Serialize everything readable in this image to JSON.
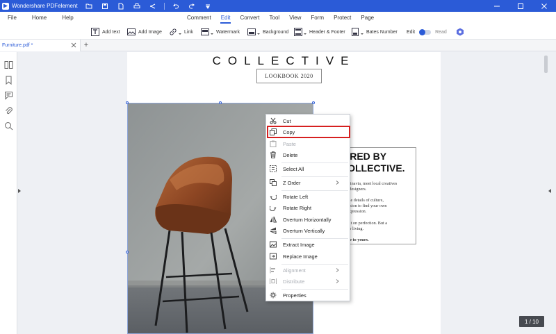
{
  "titlebar": {
    "app_title": "Wondershare PDFelement",
    "quick_tools": [
      "open-folder-icon",
      "save-icon",
      "new-doc-icon",
      "print-icon",
      "share-icon",
      "undo-icon",
      "redo-icon",
      "dropdown-icon"
    ]
  },
  "menubar": {
    "left": [
      "File",
      "Home",
      "Help"
    ],
    "tabs": [
      "Comment",
      "Edit",
      "Convert",
      "Tool",
      "View",
      "Form",
      "Protect",
      "Page"
    ],
    "active_tab": "Edit"
  },
  "toolbar": {
    "add_text": "Add text",
    "add_image": "Add Image",
    "link": "Link",
    "watermark": "Watermark",
    "background": "Background",
    "header_footer": "Header & Footer",
    "bates_number": "Bates Number",
    "edit": "Edit",
    "read": "Read"
  },
  "tabs": {
    "doc_tab": "Furniture.pdf *",
    "new_tab": "+"
  },
  "page": {
    "title": "COLLECTIVE",
    "subtitle": "LOOKBOOK 2020",
    "heading_line1": "PIRED BY",
    "heading_line2": "COLLECTIVE.",
    "para1_l1": "andinavia, meet local creatives",
    "para1_l2": "ed designers.",
    "para2_l1": "y the details of culture,",
    "para2_l2": "passion to find your own",
    "para2_l3": "e expression.",
    "para3_l1": "built on perfection. But a",
    "para3_l2": "t for living.",
    "para4": "ome to yours."
  },
  "context_menu": {
    "cut": "Cut",
    "copy": "Copy",
    "paste": "Paste",
    "delete": "Delete",
    "select_all": "Select All",
    "z_order": "Z Order",
    "rotate_left": "Rotate Left",
    "rotate_right": "Rotate Right",
    "overturn_h": "Overturn Horizontally",
    "overturn_v": "Overturn Vertically",
    "extract_image": "Extract Image",
    "replace_image": "Replace Image",
    "alignment": "Alignment",
    "distribute": "Distribute",
    "properties": "Properties"
  },
  "status": {
    "page_counter": "1 / 10"
  },
  "colors": {
    "accent": "#2b5bd7",
    "highlight": "#d62020"
  }
}
